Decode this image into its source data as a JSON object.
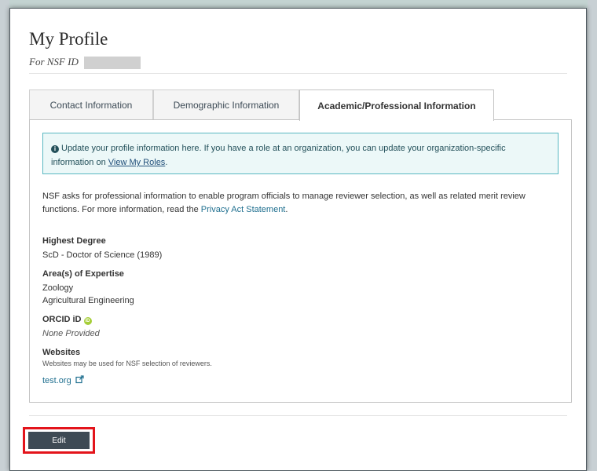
{
  "header": {
    "title": "My Profile",
    "subtitle_prefix": "For NSF ID"
  },
  "tabs": [
    {
      "label": "Contact Information",
      "active": false
    },
    {
      "label": "Demographic Information",
      "active": false
    },
    {
      "label": "Academic/Professional Information",
      "active": true
    }
  ],
  "alert": {
    "icon": "info-icon",
    "text": "Update your profile information here. If you have a role at an organization, you can update your organization-specific information on ",
    "link_label": "View My Roles",
    "text_end": "."
  },
  "intro": {
    "text": "NSF asks for professional information to enable program officials to manage reviewer selection, as well as related merit review functions. For more information, read the ",
    "link_label": "Privacy Act Statement",
    "text_end": "."
  },
  "fields": {
    "highest_degree": {
      "label": "Highest Degree",
      "value": "ScD - Doctor of Science (1989)"
    },
    "expertise": {
      "label": "Area(s) of Expertise",
      "values": [
        "Zoology",
        "Agricultural Engineering"
      ]
    },
    "orcid": {
      "label": "ORCID iD",
      "value": "None Provided"
    },
    "websites": {
      "label": "Websites",
      "note": "Websites may be used for NSF selection of reviewers.",
      "link": "test.org"
    }
  },
  "actions": {
    "edit_label": "Edit"
  },
  "colors": {
    "accent": "#59b8c2",
    "button": "#3e4a54",
    "highlight": "#e3141b",
    "orcid": "#a6ce39"
  }
}
